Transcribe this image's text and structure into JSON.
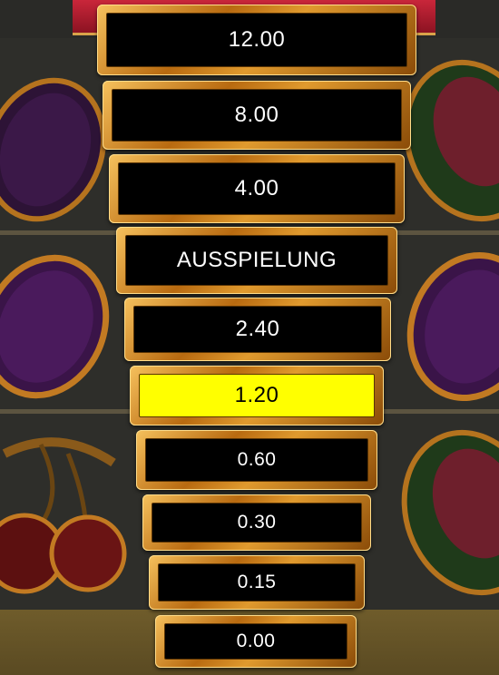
{
  "ladder": {
    "steps": [
      {
        "label": "12.00"
      },
      {
        "label": "8.00"
      },
      {
        "label": "4.00"
      },
      {
        "label": "AUSSPIELUNG"
      },
      {
        "label": "2.40"
      },
      {
        "label": "1.20"
      },
      {
        "label": "0.60"
      },
      {
        "label": "0.30"
      },
      {
        "label": "0.15"
      },
      {
        "label": "0.00"
      }
    ],
    "active_step": "1.20"
  },
  "colors": {
    "active_fill": "#ffff00",
    "step_fill": "#000000",
    "frame_gold": "#d98a1f"
  },
  "background": {
    "symbols": [
      "plum-icon",
      "watermelon-icon",
      "plum-icon",
      "plum-icon",
      "cherry-icon",
      "watermelon-icon"
    ]
  }
}
